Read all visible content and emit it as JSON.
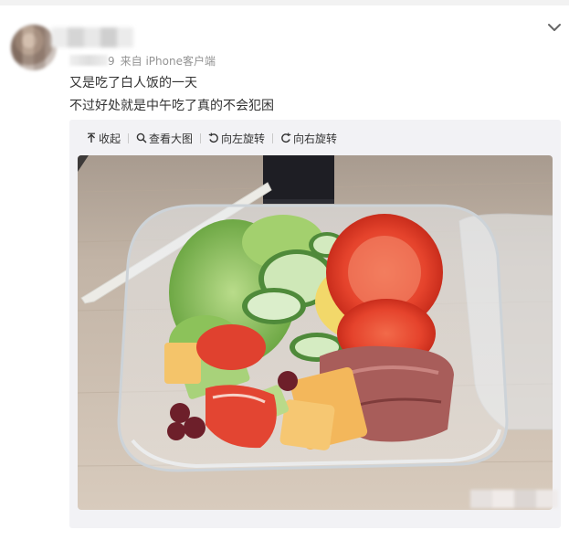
{
  "post": {
    "meta_date_fragment": "9",
    "source": "来自 iPhone客户端",
    "lines": [
      "又是吃了白人饭的一天",
      "不过好处就是中午吃了真的不会犯困"
    ]
  },
  "toolbar": {
    "collect": "收起",
    "view_large": "查看大图",
    "rotate_left": "向左旋转",
    "rotate_right": "向右旋转"
  },
  "icons": {
    "collapse": "collapse-arrow-icon",
    "search": "search-icon",
    "rotate_left": "rotate-left-icon",
    "rotate_right": "rotate-right-icon",
    "expand": "chevron-down-icon"
  },
  "colors": {
    "text": "#333333",
    "meta": "#939393",
    "media_bg": "#f2f2f5"
  }
}
